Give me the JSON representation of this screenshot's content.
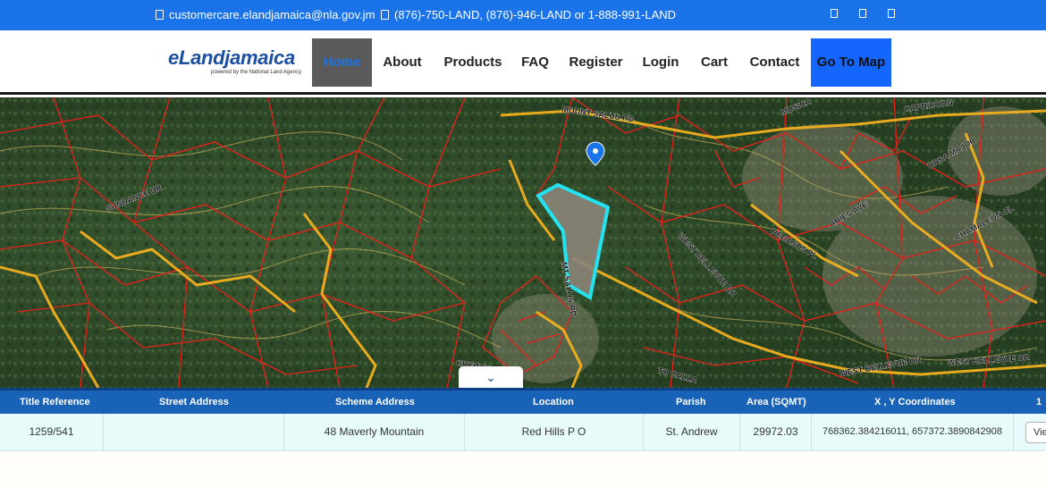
{
  "topbar": {
    "email": "customercare.elandjamaica@nla.gov.jm",
    "phones": "(876)-750-LAND, (876)-946-LAND or 1-888-991-LAND"
  },
  "brand": {
    "name": "eLandjamaica",
    "tagline": "powered by the National Land Agency"
  },
  "nav": {
    "items": [
      "Home",
      "About",
      "Products",
      "FAQ",
      "Register",
      "Login",
      "Cart",
      "Contact",
      "Go To Map"
    ],
    "active": "Home"
  },
  "map": {
    "road_labels": [
      "MOUNT SALUS RD",
      "MUSICA",
      "CAPRICORN",
      "URSA MAJOR",
      "ARIES AVE",
      "PEGASUS PL",
      "CHAMALEON CL",
      "WEST BELLEVUE DR",
      "MT SALUS RD",
      "SUNDANCE DR",
      "CHERRY",
      "TO CALLA",
      "WEST BELLEVUE DR",
      "WEST BELLEVUE DR"
    ],
    "colors": {
      "parcel_lines": "#e8201a",
      "roads": "#f2b01e",
      "contours": "#c9b25a",
      "highlight": "#22e3ef",
      "pin": "#1a73e8"
    }
  },
  "collapse_icon": "chevrons-down-icon",
  "results": {
    "columns": [
      "Title Reference",
      "Street Address",
      "Scheme Address",
      "Location",
      "Parish",
      "Area (SQMT)",
      "X , Y Coordinates",
      "1"
    ],
    "rows": [
      {
        "title_reference": "1259/541",
        "street_address": "",
        "scheme_address": "48 Maverly Mountain",
        "location": "Red Hills P O",
        "parish": "St. Andrew",
        "area": "29972.03",
        "coordinates": "768362.384216011, 657372.3890842908",
        "action": "View"
      }
    ]
  }
}
